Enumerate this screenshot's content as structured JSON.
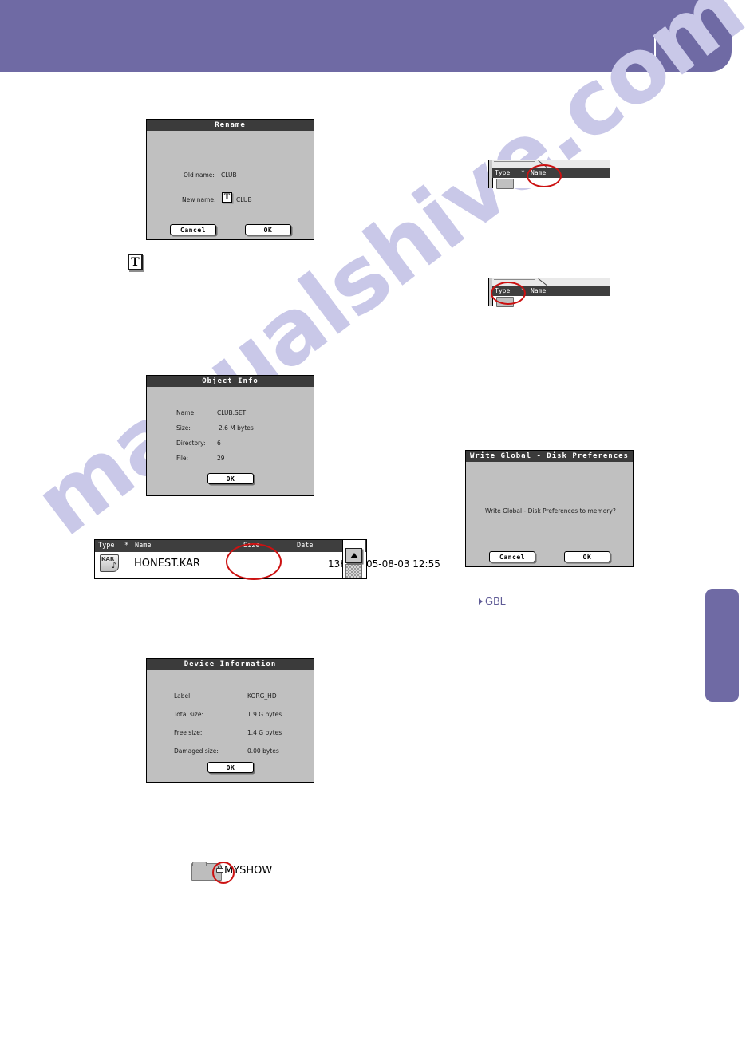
{
  "header": {
    "accent_color": "#6f6aa4"
  },
  "watermark": {
    "text": "manualshive.com"
  },
  "rename_dialog": {
    "title": "Rename",
    "old_name_label": "Old name:",
    "old_name_value": "CLUB",
    "new_name_label": "New name:",
    "new_name_value": "CLUB",
    "text_icon": "T",
    "cancel_label": "Cancel",
    "ok_label": "OK"
  },
  "text_edit_icon": {
    "glyph": "T"
  },
  "object_info_dialog": {
    "title": "Object Info",
    "rows": [
      {
        "label": "Name:",
        "value": "CLUB.SET"
      },
      {
        "label": "Size:",
        "value": "2.6 M bytes"
      },
      {
        "label": "Directory:",
        "value": "6"
      },
      {
        "label": "File:",
        "value": "29"
      }
    ],
    "ok_label": "OK"
  },
  "file_browser": {
    "columns": {
      "type": "Type",
      "star": "*",
      "name": "Name",
      "size": "Size",
      "date": "Date"
    },
    "row": {
      "icon_label": "KAR",
      "name": "HONEST.KAR",
      "size": "13K",
      "date": "05-08-03 12:55"
    },
    "highlight": "size"
  },
  "device_information_dialog": {
    "title": "Device Information",
    "rows": [
      {
        "label": "Label:",
        "value": "KORG_HD"
      },
      {
        "label": "Total size:",
        "value": "1.9 G bytes"
      },
      {
        "label": "Free size:",
        "value": "1.4 G bytes"
      },
      {
        "label": "Damaged size:",
        "value": "0.00   bytes"
      }
    ],
    "ok_label": "OK"
  },
  "mini_list_name": {
    "type_label": "Type",
    "star": "*",
    "name_label": "Name",
    "highlight": "Name"
  },
  "mini_list_type": {
    "type_label": "Type",
    "star": "*",
    "name_label": "Name",
    "highlight": "Type"
  },
  "write_global_dialog": {
    "title": "Write Global - Disk Preferences",
    "message": "Write Global - Disk Preferences to memory?",
    "cancel_label": "Cancel",
    "ok_label": "OK"
  },
  "gbl_reference": {
    "label": "GBL"
  },
  "protected_folder": {
    "name": "MYSHOW",
    "icon": "locked-folder-icon"
  }
}
